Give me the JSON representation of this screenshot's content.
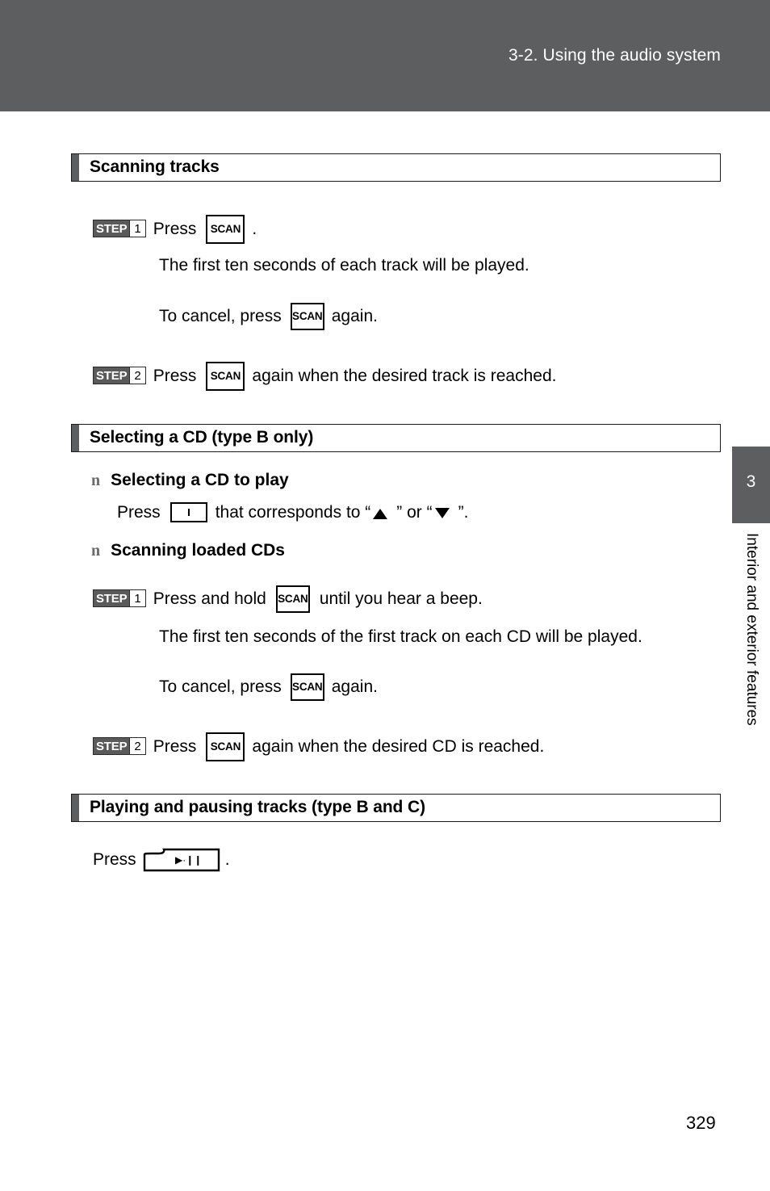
{
  "header": {
    "title": "3-2. Using the audio system",
    "band_color": "#5c5e60"
  },
  "side_tab": {
    "chapter_number": "3",
    "chapter_label": "Interior and exterior features",
    "color": "#5c5e60"
  },
  "page_number": "329",
  "sections": [
    {
      "heading": "Scanning tracks",
      "steps": [
        {
          "badge_word": "STEP",
          "badge_num": "1",
          "text_before": "Press",
          "key": "SCAN",
          "text_after": ".",
          "notes": [
            "The first ten seconds of each track will be played.",
            {
              "text_before": "To cancel, press",
              "key": "SCAN",
              "text_after": "again."
            }
          ]
        },
        {
          "badge_word": "STEP",
          "badge_num": "2",
          "text_before": "Press",
          "key": "SCAN",
          "text_after": "again when the desired track is reached."
        }
      ]
    },
    {
      "heading": "Selecting a CD (type B only)",
      "subsections": [
        {
          "bullet": "square-bullet-icon",
          "title": "Selecting a CD to play",
          "body_before": "Press",
          "key_glyph": "I",
          "body_middle": "that corresponds to “",
          "arrow_up": "up-triangle-icon",
          "body_or": "” or “",
          "arrow_down": "down-triangle-icon",
          "body_after": "”."
        },
        {
          "bullet": "square-bullet-icon",
          "title": "Scanning loaded CDs",
          "steps": [
            {
              "badge_word": "STEP",
              "badge_num": "1",
              "text_before": "Press and hold",
              "key": "SCAN",
              "text_after": "until you hear a beep.",
              "notes": [
                "The first ten seconds of the first track on each CD will be played.",
                {
                  "text_before": "To cancel, press",
                  "key": "SCAN",
                  "text_after": "again."
                }
              ]
            },
            {
              "badge_word": "STEP",
              "badge_num": "2",
              "text_before": "Press",
              "key": "SCAN",
              "text_after": "again when the desired CD is reached."
            }
          ]
        }
      ]
    },
    {
      "heading": "Playing and pausing tracks (type B and C)",
      "press_line": {
        "text_before": "Press",
        "key": "play-pause-icon",
        "key_glyph": "▶·❙❙",
        "text_after": "."
      }
    }
  ]
}
